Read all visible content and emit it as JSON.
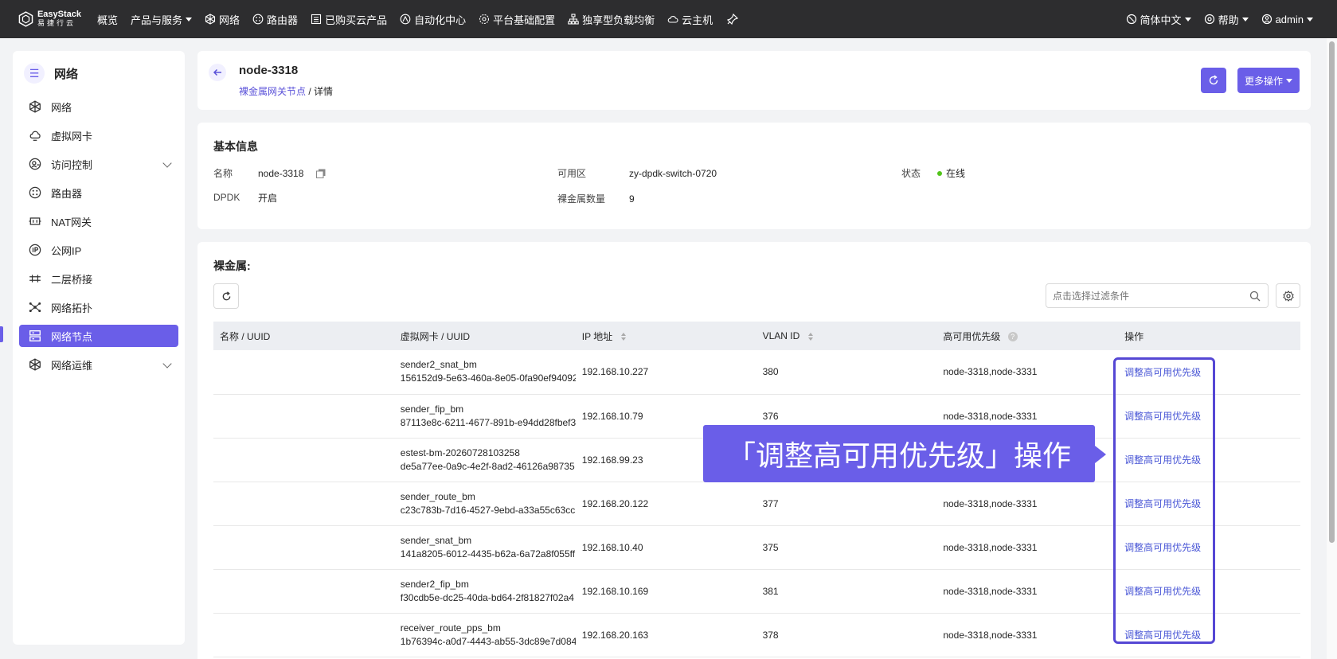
{
  "topbar": {
    "logo_en": "EasyStack",
    "logo_cn": "易捷行云",
    "nav": [
      {
        "label": "概览",
        "icon": "",
        "caret": false
      },
      {
        "label": "产品与服务",
        "icon": "",
        "caret": true
      },
      {
        "label": "网络",
        "icon": "network-icon",
        "caret": false
      },
      {
        "label": "路由器",
        "icon": "router-icon",
        "caret": false
      },
      {
        "label": "已购买云产品",
        "icon": "list-icon",
        "caret": false
      },
      {
        "label": "自动化中心",
        "icon": "automation-icon",
        "caret": false
      },
      {
        "label": "平台基础配置",
        "icon": "gear-icon",
        "caret": false
      },
      {
        "label": "独享型负载均衡",
        "icon": "load-balancer-icon",
        "caret": false
      },
      {
        "label": "云主机",
        "icon": "cloud-icon",
        "caret": false
      }
    ],
    "language": "简体中文",
    "help": "帮助",
    "user": "admin"
  },
  "sidebar": {
    "title": "网络",
    "items": [
      {
        "label": "网络",
        "icon": "network-icon",
        "expandable": false,
        "active": false
      },
      {
        "label": "虚拟网卡",
        "icon": "virtual-nic-icon",
        "expandable": false,
        "active": false
      },
      {
        "label": "访问控制",
        "icon": "access-control-icon",
        "expandable": true,
        "active": false
      },
      {
        "label": "路由器",
        "icon": "router-icon",
        "expandable": false,
        "active": false
      },
      {
        "label": "NAT网关",
        "icon": "nat-gateway-icon",
        "expandable": false,
        "active": false
      },
      {
        "label": "公网IP",
        "icon": "public-ip-icon",
        "expandable": false,
        "active": false
      },
      {
        "label": "二层桥接",
        "icon": "bridge-icon",
        "expandable": false,
        "active": false
      },
      {
        "label": "网络拓扑",
        "icon": "topology-icon",
        "expandable": false,
        "active": false
      },
      {
        "label": "网络节点",
        "icon": "network-node-icon",
        "expandable": false,
        "active": true
      },
      {
        "label": "网络运维",
        "icon": "network-ops-icon",
        "expandable": true,
        "active": false
      }
    ]
  },
  "header": {
    "title": "node-3318",
    "breadcrumb_link": "裸金属网关节点",
    "breadcrumb_sep": "/",
    "breadcrumb_current": "详情",
    "more_actions": "更多操作"
  },
  "info": {
    "section_title": "基本信息",
    "name_label": "名称",
    "name_value": "node-3318",
    "az_label": "可用区",
    "az_value": "zy-dpdk-switch-0720",
    "status_label": "状态",
    "status_value": "在线",
    "status_color": "#52c41a",
    "dpdk_label": "DPDK",
    "dpdk_value": "开启",
    "bm_count_label": "裸金属数量",
    "bm_count_value": "9"
  },
  "baremetal": {
    "section_title": "裸金属:",
    "search_placeholder": "点击选择过滤条件",
    "columns": [
      "名称 / UUID",
      "虚拟网卡 / UUID",
      "IP 地址",
      "VLAN ID",
      "高可用优先级",
      "操作"
    ],
    "rows": [
      {
        "name": "",
        "nic_name": "sender2_snat_bm",
        "nic_uuid": "156152d9-5e63-460a-8e05-0fa90ef94092",
        "ip": "192.168.10.227",
        "vlan": "380",
        "priority": "node-3318,node-3331",
        "action": "调整高可用优先级"
      },
      {
        "name": "",
        "nic_name": "sender_fip_bm",
        "nic_uuid": "87113e8c-6211-4677-891b-e94dd28fbef3",
        "ip": "192.168.10.79",
        "vlan": "376",
        "priority": "node-3318,node-3331",
        "action": "调整高可用优先级"
      },
      {
        "name": "",
        "nic_name": "estest-bm-20260728103258",
        "nic_uuid": "de5a77ee-0a9c-4e2f-8ad2-46126a98735",
        "ip": "192.168.99.23",
        "vlan": "",
        "priority": "",
        "action": "调整高可用优先级"
      },
      {
        "name": "",
        "nic_name": "sender_route_bm",
        "nic_uuid": "c23c783b-7d16-4527-9ebd-a33a55c63cc",
        "ip": "192.168.20.122",
        "vlan": "377",
        "priority": "node-3318,node-3331",
        "action": "调整高可用优先级"
      },
      {
        "name": "",
        "nic_name": "sender_snat_bm",
        "nic_uuid": "141a8205-6012-4435-b62a-6a72a8f055ff",
        "ip": "192.168.10.40",
        "vlan": "375",
        "priority": "node-3318,node-3331",
        "action": "调整高可用优先级"
      },
      {
        "name": "",
        "nic_name": "sender2_fip_bm",
        "nic_uuid": "f30cdb5e-dc25-40da-bd64-2f81827f02a4",
        "ip": "192.168.10.169",
        "vlan": "381",
        "priority": "node-3318,node-3331",
        "action": "调整高可用优先级"
      },
      {
        "name": "",
        "nic_name": "receiver_route_pps_bm",
        "nic_uuid": "1b76394c-a0d7-4443-ab55-3dc89e7d084",
        "ip": "192.168.20.163",
        "vlan": "378",
        "priority": "node-3318,node-3331",
        "action": "调整高可用优先级"
      }
    ]
  },
  "annotation": {
    "callout_text": "「调整高可用优先级」操作"
  },
  "colors": {
    "accent": "#6a5ee8",
    "topbar": "#2d2d2f",
    "link": "#4a57d6"
  }
}
